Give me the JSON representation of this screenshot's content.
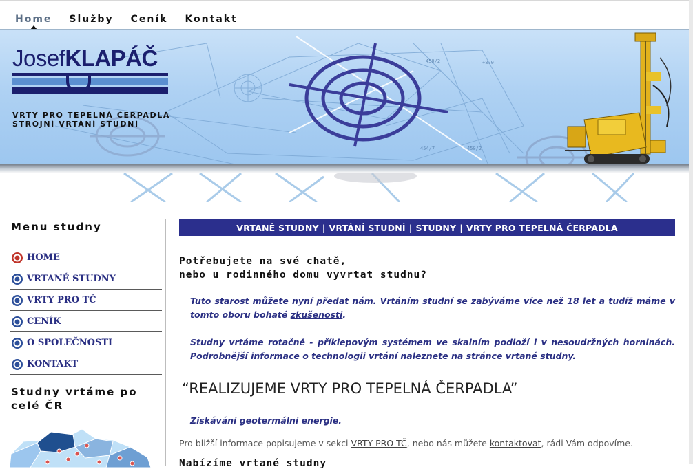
{
  "nav": {
    "items": [
      {
        "label": "Home",
        "active": true
      },
      {
        "label": "Služby",
        "active": false
      },
      {
        "label": "Ceník",
        "active": false
      },
      {
        "label": "Kontakt",
        "active": false
      }
    ]
  },
  "banner": {
    "logo_first": "Josef",
    "logo_last": "KLAPÁČ",
    "tagline_1": "VRTY PRO TEPELNÁ ČERPADLA",
    "tagline_2": "STROJNÍ VRTÁNÍ STUDNÍ"
  },
  "sidebar": {
    "menu_heading": "Menu studny",
    "items": [
      {
        "label": "HOME",
        "active": true
      },
      {
        "label": "VRTANÉ STUDNY",
        "active": false
      },
      {
        "label": "VRTY PRO TČ",
        "active": false
      },
      {
        "label": "CENÍK",
        "active": false
      },
      {
        "label": "O SPOLEČNOSTI",
        "active": false
      },
      {
        "label": "KONTAKT",
        "active": false
      }
    ],
    "region_heading_1": "Studny vrtáme po",
    "region_heading_2": "celé ČR"
  },
  "main": {
    "crumbs": [
      "VRTANÉ STUDNY",
      "VRTÁNÍ STUDNÍ",
      "STUDNY",
      "VRTY PRO TEPELNÁ ČERPADLA"
    ],
    "crumb_sep": "|",
    "question_1": "Potřebujete na své chatě,",
    "question_2": "nebo u rodinného domu vyvrtat studnu?",
    "p1_text": "Tuto starost můžete nyní předat nám. Vrtáním studní se zabýváme více než 18 let a tudíž máme v tomto oboru bohaté ",
    "p1_link": "zkušenosti",
    "p1_end": ".",
    "p2_text": "Studny vrtáme rotačně - příklepovým systémem ve skalním podloží i v nesoudržných horninách. Podrobnější informace o technologii vrtání naleznete na stránce ",
    "p2_link": "vrtané studny",
    "p2_end": ".",
    "headline": "“REALIZUJEME VRTY PRO TEPELNÁ ČERPADLA”",
    "geo": "Získávání geotermální energie.",
    "info_text_1": "Pro bližší informace popisujeme v sekci ",
    "info_link_1": "VRTY PRO TČ",
    "info_text_2": ", nebo nás můžete ",
    "info_link_2": "kontaktovat",
    "info_text_3": ", rádi Vám odpovíme.",
    "next_heading": "Nabízíme vrtané studny"
  },
  "colors": {
    "brand_blue": "#2b2f8d",
    "link_blue": "#2a2f83",
    "banner_blue": "#aed1f3",
    "active_bullet": "#c0352b"
  }
}
